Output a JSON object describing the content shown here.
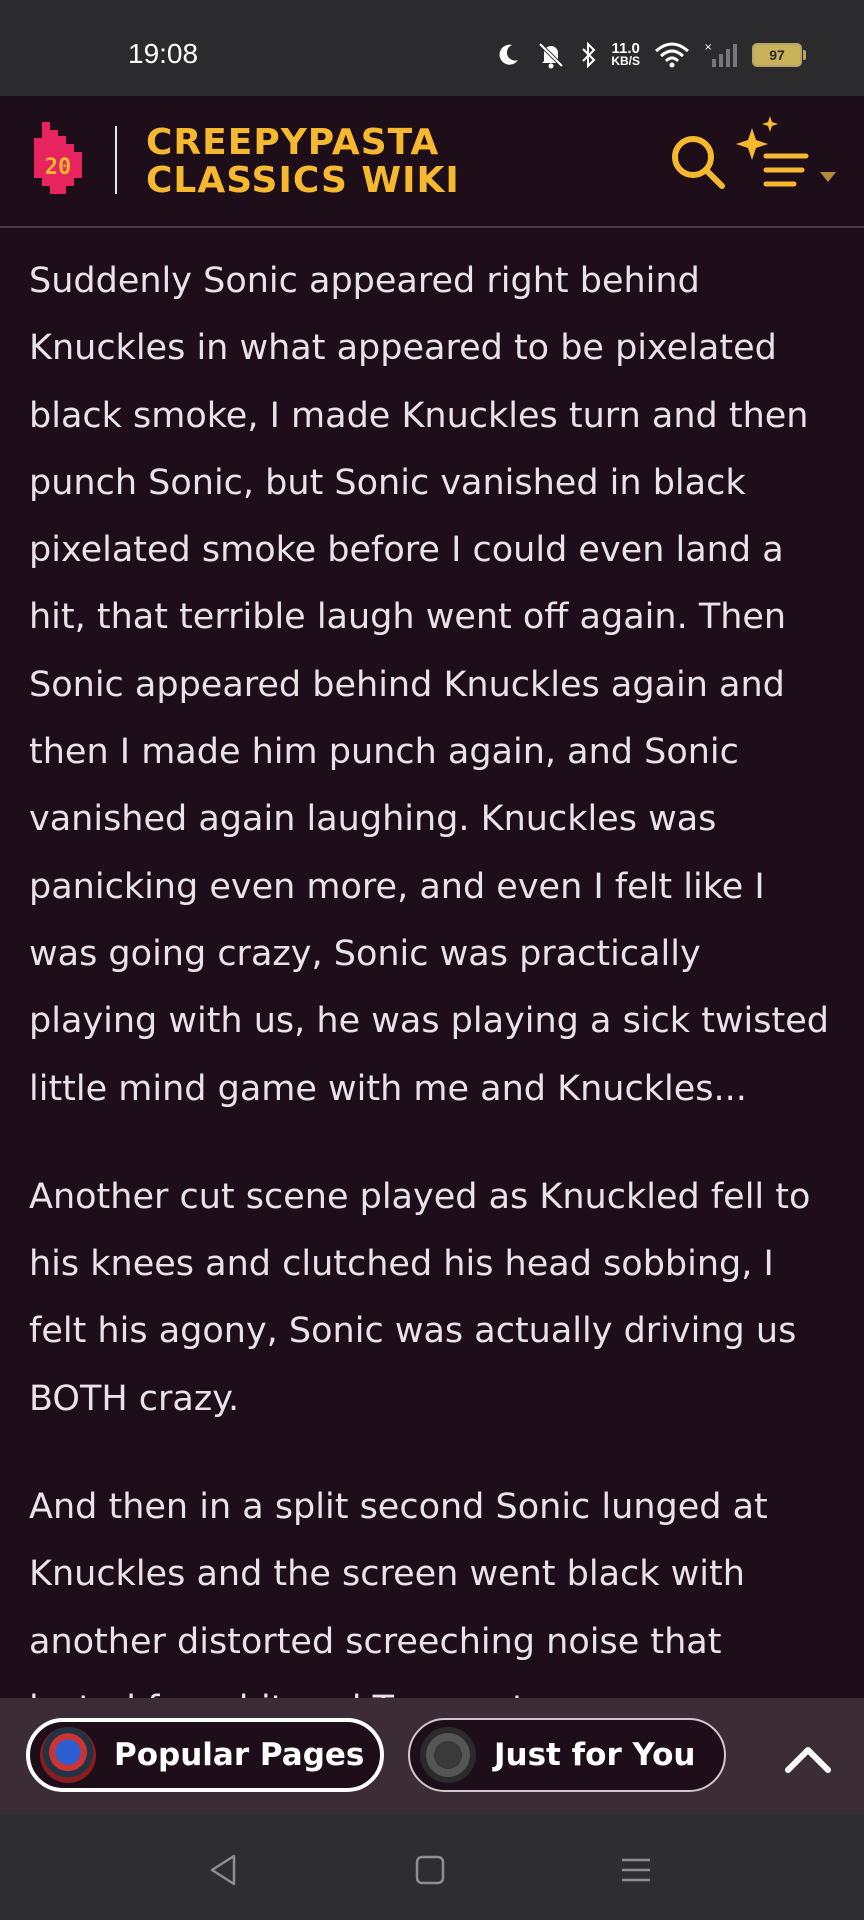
{
  "status_bar": {
    "time": "19:08",
    "net_speed_value": "11.0",
    "net_speed_unit": "KB/S",
    "battery": "97",
    "icons": [
      "moon-icon",
      "mute-bell-icon",
      "bluetooth-icon",
      "wifi-icon",
      "signal-icon"
    ]
  },
  "header": {
    "logo_number": "20",
    "title": "CREEPYPASTA\nCLASSICS WIKI",
    "accent": "#f5b82e",
    "logo_color": "#e8245e"
  },
  "article": {
    "paragraphs": [
      "Suddenly Sonic appeared right behind Knuckles in what appeared to be pixelated black smoke, I made Knuckles turn and then punch Sonic, but Sonic vanished in black pixelated smoke before I could even land a hit, that terrible laugh went off again. Then Sonic appeared behind Knuckles again and then I made him punch again, and Sonic vanished again laughing. Knuckles was panicking even more, and even I felt like I was going crazy, Sonic was practically playing with us, he was playing a sick twisted little mind game with me and Knuckles...",
      "Another cut scene played as Knuckled fell to his knees and clutched his head sobbing, I felt his agony, Sonic was actually driving us BOTH crazy.",
      "And then in a split second Sonic lunged at Knuckles and the screen went black with another distorted screeching noise that lasted for a bit and Tor meet"
    ]
  },
  "recommendations": {
    "popular_label": "Popular Pages",
    "for_you_label": "Just for You"
  }
}
